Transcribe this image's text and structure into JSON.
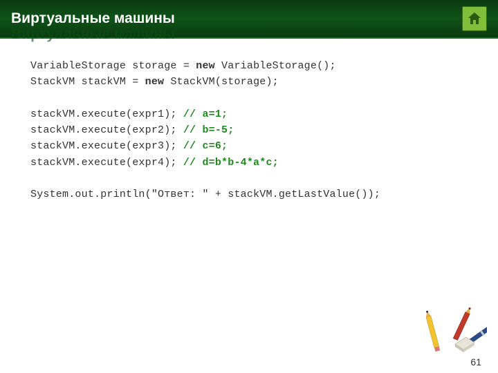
{
  "header": {
    "title": "Виртуальные машины",
    "home_label": "home"
  },
  "code": {
    "line1_a": "VariableStorage storage = ",
    "line1_kw": "new",
    "line1_b": " VariableStorage();",
    "line2_a": "StackVM stackVM = ",
    "line2_kw": "new",
    "line2_b": " StackVM(storage);",
    "blank1": "",
    "line3_a": "stackVM.execute(expr1); ",
    "line3_c": "// a=1;",
    "line4_a": "stackVM.execute(expr2); ",
    "line4_c": "// b=-5;",
    "line5_a": "stackVM.execute(expr3); ",
    "line5_c": "// c=6;",
    "line6_a": "stackVM.execute(expr4); ",
    "line6_c": "// d=b*b-4*a*c;",
    "blank2": "",
    "line7": "System.out.println(\"Ответ: \" + stackVM.getLastValue());"
  },
  "page_number": "61"
}
